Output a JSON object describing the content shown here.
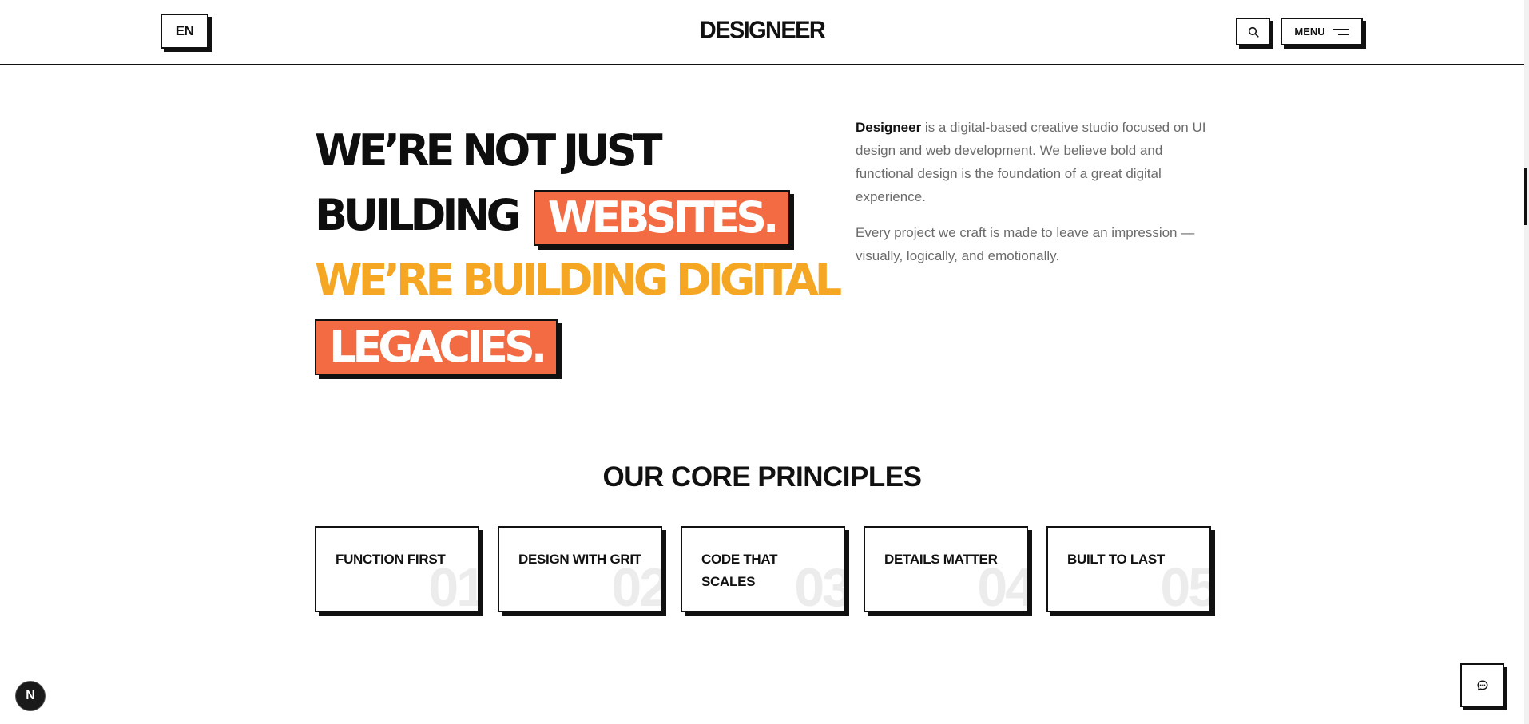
{
  "header": {
    "lang_label": "EN",
    "logo_text": "DESIGNEER",
    "search_icon": "search-icon",
    "menu_label": "MENU",
    "menu_icon": "hamburger-icon"
  },
  "hero": {
    "line1": "WE’RE NOT JUST",
    "line2_prefix": "BUILDING",
    "line2_tag": "WEBSITES.",
    "line3": "WE’RE BUILDING DIGITAL",
    "line4_tag": "LEGACIES.",
    "accent_color": "#f26b43",
    "highlight_color": "#f5a623"
  },
  "intro": {
    "brand": "Designeer",
    "p1_rest": " is a digital-based creative studio focused on UI design and web development. We believe bold and functional design is the foundation of a great digital experience.",
    "p2": "Every project we craft is made to leave an impression — visually, logically, and emotionally."
  },
  "principles": {
    "title": "OUR CORE PRINCIPLES",
    "items": [
      {
        "label": "FUNCTION FIRST",
        "num": "01"
      },
      {
        "label": "DESIGN WITH GRIT",
        "num": "02"
      },
      {
        "label": "CODE THAT SCALES",
        "num": "03"
      },
      {
        "label": "DETAILS MATTER",
        "num": "04"
      },
      {
        "label": "BUILT TO LAST",
        "num": "05"
      }
    ]
  },
  "floating": {
    "dev_badge_letter": "N",
    "chat_icon": "chat-bubble-icon"
  }
}
